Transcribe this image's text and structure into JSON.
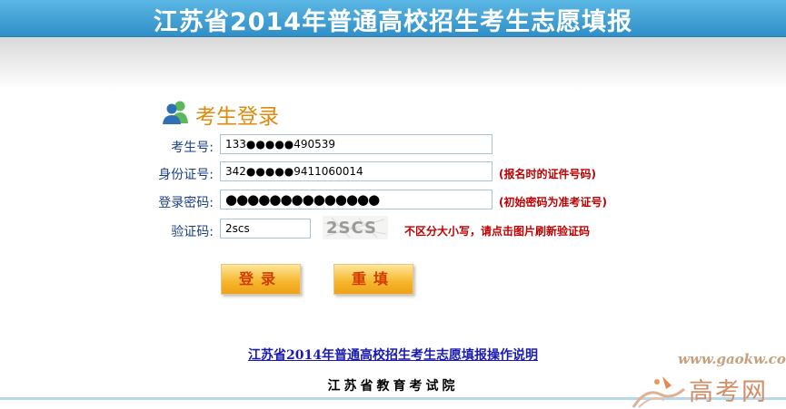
{
  "header": {
    "title": "江苏省2014年普通高校招生考生志愿填报"
  },
  "login": {
    "heading": "考生登录",
    "fields": {
      "exam_id": {
        "label": "考生号:",
        "value": "133●●●●●490539"
      },
      "id_number": {
        "label": "身份证号:",
        "value": "342●●●●●9411060014",
        "hint": "(报名时的证件号码)"
      },
      "password": {
        "label": "登录密码:",
        "value": "●●●●●●●●●●●●●●",
        "hint": "(初始密码为准考证号)"
      },
      "captcha": {
        "label": "验证码:",
        "value": "2scs",
        "image_text": "2SCS",
        "hint": "不区分大小写，请点击图片刷新验证码"
      }
    },
    "buttons": {
      "login": "登录",
      "reset": "重填"
    }
  },
  "help_link": "江苏省2014年普通高校招生考生志愿填报操作说明",
  "footer": "江苏省教育考试院",
  "watermark": {
    "url": "www.gaokw.com",
    "name": "高考网"
  },
  "colors": {
    "header_blue": "#3a9fd6",
    "heading_orange": "#e08a0a",
    "label_blue": "#1a3f8a",
    "hint_red": "#c00000",
    "button_text": "#d33b00"
  },
  "icons": {
    "heading": "users-icon",
    "watermark": "gaokw-logo-icon"
  }
}
